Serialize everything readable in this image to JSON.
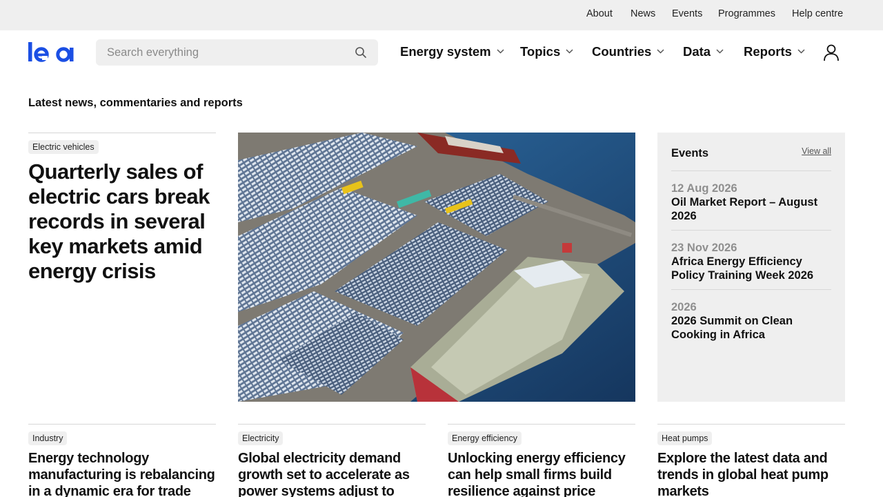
{
  "utility_nav": [
    "About",
    "News",
    "Events",
    "Programmes",
    "Help centre"
  ],
  "logo_alt": "iea",
  "search": {
    "placeholder": "Search everything"
  },
  "main_nav": [
    "Energy system",
    "Topics",
    "Countries",
    "Data",
    "Reports"
  ],
  "section_title": "Latest news, commentaries and reports",
  "featured": {
    "tag": "Electric vehicles",
    "title": "Quarterly sales of electric cars break records in several key markets amid energy crisis"
  },
  "events": {
    "title": "Events",
    "view_all": "View all",
    "items": [
      {
        "date": "12 Aug 2026",
        "name": "Oil Market Report – August 2026"
      },
      {
        "date": "23 Nov 2026",
        "name": "Africa Energy Efficiency Policy Training Week 2026"
      },
      {
        "date": "2026",
        "name": "2026 Summit on Clean Cooking in Africa"
      }
    ]
  },
  "cards": [
    {
      "tag": "Industry",
      "title": "Energy technology manufacturing is rebalancing in a dynamic era for trade"
    },
    {
      "tag": "Electricity",
      "title": "Global electricity demand growth set to accelerate as power systems adjust to"
    },
    {
      "tag": "Energy efficiency",
      "title": "Unlocking energy efficiency can help small firms build resilience against price"
    },
    {
      "tag": "Heat pumps",
      "title": "Explore the latest data and trends in global heat pump markets"
    }
  ],
  "colors": {
    "brand": "#1b4fe4",
    "panel": "#efefef"
  }
}
